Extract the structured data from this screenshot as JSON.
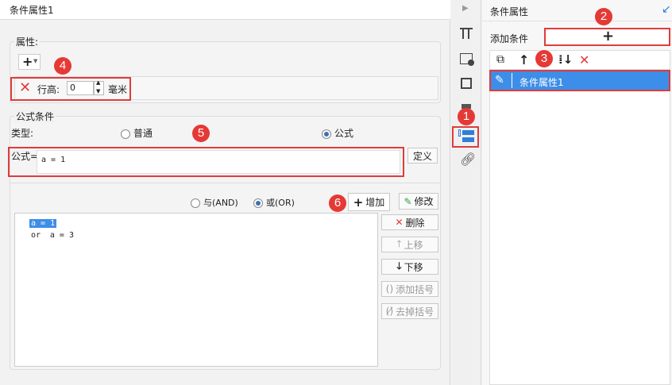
{
  "dialog": {
    "title": "条件属性1"
  },
  "attr_section": {
    "legend": "属性:",
    "add_symbol": "+",
    "row_height_label": "行高:",
    "row_height_value": "0",
    "unit": "毫米"
  },
  "formula_section": {
    "legend": "公式条件",
    "type_label": "类型:",
    "type_normal": "普通",
    "type_formula": "公式",
    "formula_label": "公式=",
    "formula_value": "a = 1",
    "define_button": "定义"
  },
  "conditions": {
    "and_label": "与(AND)",
    "or_label": "或(OR)",
    "add_button": "增加",
    "modify_button": "修改",
    "lines": [
      {
        "prefix": "",
        "text": "a = 1"
      },
      {
        "prefix": "or",
        "text": "a = 3"
      }
    ],
    "delete_button": "删除",
    "up_button": "上移",
    "down_button": "下移",
    "add_bracket_button": "添加括号",
    "remove_bracket_button": "去掉括号"
  },
  "right_panel": {
    "title": "条件属性",
    "add_condition_label": "添加条件",
    "add_symbol": "+",
    "list": [
      {
        "label": "条件属性1"
      }
    ]
  },
  "annotations": [
    "1",
    "2",
    "3",
    "4",
    "5",
    "6"
  ],
  "colors": {
    "accent": "#2f7fd9",
    "highlight_red": "#e03b3b",
    "selection_blue": "#3d8ee8"
  }
}
